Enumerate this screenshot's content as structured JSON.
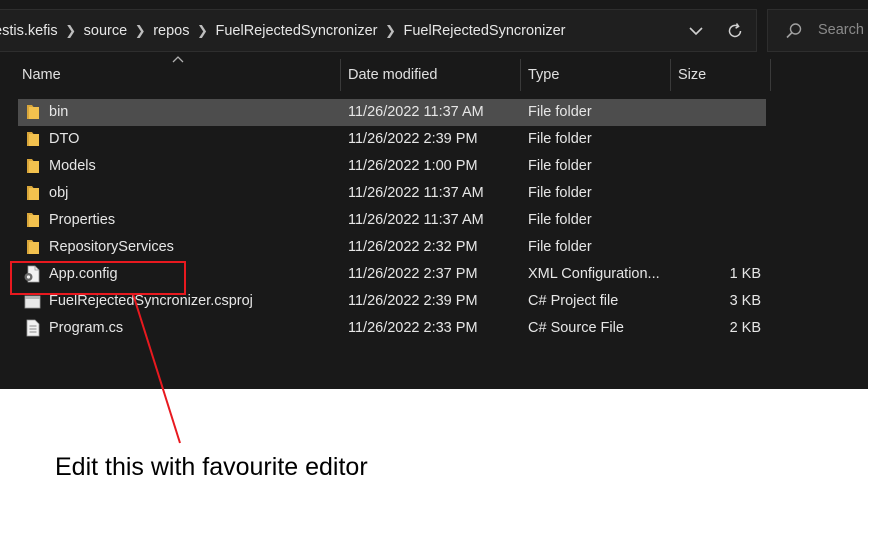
{
  "breadcrumb": [
    "estis.kefis",
    "source",
    "repos",
    "FuelRejectedSyncronizer",
    "FuelRejectedSyncronizer"
  ],
  "search": {
    "placeholder": "Search"
  },
  "columns": {
    "name": "Name",
    "date": "Date modified",
    "type": "Type",
    "size": "Size"
  },
  "rows": [
    {
      "name": "bin",
      "date": "11/26/2022 11:37 AM",
      "type": "File folder",
      "size": "",
      "icon": "folder-icon",
      "selected": true
    },
    {
      "name": "DTO",
      "date": "11/26/2022 2:39 PM",
      "type": "File folder",
      "size": "",
      "icon": "folder-icon"
    },
    {
      "name": "Models",
      "date": "11/26/2022 1:00 PM",
      "type": "File folder",
      "size": "",
      "icon": "folder-icon"
    },
    {
      "name": "obj",
      "date": "11/26/2022 11:37 AM",
      "type": "File folder",
      "size": "",
      "icon": "folder-icon"
    },
    {
      "name": "Properties",
      "date": "11/26/2022 11:37 AM",
      "type": "File folder",
      "size": "",
      "icon": "folder-icon"
    },
    {
      "name": "RepositoryServices",
      "date": "11/26/2022 2:32 PM",
      "type": "File folder",
      "size": "",
      "icon": "folder-icon"
    },
    {
      "name": "App.config",
      "date": "11/26/2022 2:37 PM",
      "type": "XML Configuration...",
      "size": "1 KB",
      "icon": "config-file-icon"
    },
    {
      "name": "FuelRejectedSyncronizer.csproj",
      "date": "11/26/2022 2:39 PM",
      "type": "C# Project file",
      "size": "3 KB",
      "icon": "csproj-file-icon"
    },
    {
      "name": "Program.cs",
      "date": "11/26/2022 2:33 PM",
      "type": "C# Source File",
      "size": "2 KB",
      "icon": "cs-file-icon"
    }
  ],
  "annotation": {
    "note": "Edit this with favourite editor",
    "color": "#e8191f"
  },
  "colors": {
    "folder": "#f2c14e",
    "selection": "#4d4d4d",
    "background": "#191919"
  }
}
